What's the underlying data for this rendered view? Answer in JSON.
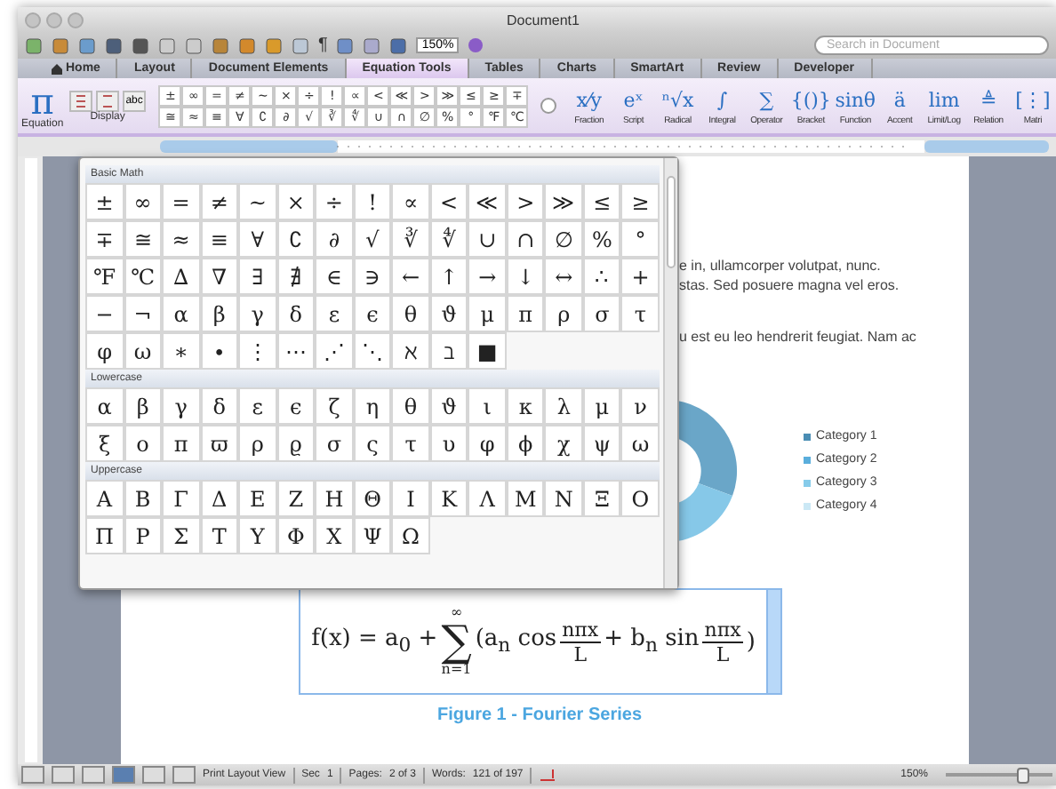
{
  "window": {
    "title": "Document1"
  },
  "toolbar": {
    "pilcrow": "¶",
    "zoom": "150%",
    "search_placeholder": "Search in Document"
  },
  "tabs": [
    {
      "label": "Home",
      "selected": false
    },
    {
      "label": "Layout",
      "selected": false
    },
    {
      "label": "Document Elements",
      "selected": false
    },
    {
      "label": "Equation Tools",
      "selected": true
    },
    {
      "label": "Tables",
      "selected": false
    },
    {
      "label": "Charts",
      "selected": false
    },
    {
      "label": "SmartArt",
      "selected": false
    },
    {
      "label": "Review",
      "selected": false
    },
    {
      "label": "Developer",
      "selected": false
    }
  ],
  "ribbon": {
    "equation": {
      "glyph": "π",
      "label": "Equation"
    },
    "display": {
      "label": "Display",
      "text_button": "abc"
    },
    "symbols": [
      [
        "±",
        "∞",
        "=",
        "≠",
        "~",
        "×",
        "÷",
        "!",
        "∝",
        "<",
        "≪",
        ">",
        "≫",
        "≤",
        "≥",
        "∓"
      ],
      [
        "≅",
        "≈",
        "≡",
        "∀",
        "∁",
        "∂",
        "√",
        "∛",
        "∜",
        "∪",
        "∩",
        "∅",
        "%",
        "°",
        "℉",
        "℃"
      ]
    ],
    "structures": [
      {
        "glyph": "x⁄y",
        "label": "Fraction"
      },
      {
        "glyph": "eˣ",
        "label": "Script"
      },
      {
        "glyph": "ⁿ√x",
        "label": "Radical"
      },
      {
        "glyph": "∫",
        "label": "Integral"
      },
      {
        "glyph": "∑",
        "label": "Operator"
      },
      {
        "glyph": "{()}",
        "label": "Bracket"
      },
      {
        "glyph": "sinθ",
        "label": "Function"
      },
      {
        "glyph": "ä",
        "label": "Accent"
      },
      {
        "glyph": "lim",
        "label": "Limit/Log"
      },
      {
        "glyph": "≜",
        "label": "Relation"
      },
      {
        "glyph": "[⋮]",
        "label": "Matri"
      }
    ]
  },
  "palette": {
    "sections": [
      {
        "title": "Basic Math",
        "rows": [
          [
            "±",
            "∞",
            "=",
            "≠",
            "~",
            "×",
            "÷",
            "!",
            "∝",
            "<",
            "≪",
            ">",
            "≫",
            "≤",
            "≥"
          ],
          [
            "∓",
            "≅",
            "≈",
            "≡",
            "∀",
            "∁",
            "∂",
            "√",
            "∛",
            "∜",
            "∪",
            "∩",
            "∅",
            "%",
            "°"
          ],
          [
            "℉",
            "℃",
            "∆",
            "∇",
            "∃",
            "∄",
            "∈",
            "∋",
            "←",
            "↑",
            "→",
            "↓",
            "↔",
            "∴",
            "+"
          ],
          [
            "−",
            "¬",
            "α",
            "β",
            "γ",
            "δ",
            "ε",
            "ϵ",
            "θ",
            "ϑ",
            "μ",
            "π",
            "ρ",
            "σ",
            "τ"
          ],
          [
            "φ",
            "ω",
            "∗",
            "∙",
            "⋮",
            "⋯",
            "⋰",
            "⋱",
            "ℵ",
            "ℶ",
            "■"
          ]
        ]
      },
      {
        "title": "Lowercase",
        "rows": [
          [
            "α",
            "β",
            "γ",
            "δ",
            "ε",
            "ϵ",
            "ζ",
            "η",
            "θ",
            "ϑ",
            "ι",
            "κ",
            "λ",
            "μ",
            "ν"
          ],
          [
            "ξ",
            "ο",
            "π",
            "ϖ",
            "ρ",
            "ϱ",
            "σ",
            "ς",
            "τ",
            "υ",
            "φ",
            "ϕ",
            "χ",
            "ψ",
            "ω"
          ]
        ]
      },
      {
        "title": "Uppercase",
        "rows": [
          [
            "Α",
            "Β",
            "Γ",
            "Δ",
            "Ε",
            "Ζ",
            "Η",
            "Θ",
            "Ι",
            "Κ",
            "Λ",
            "Μ",
            "Ν",
            "Ξ",
            "Ο"
          ],
          [
            "Π",
            "Ρ",
            "Σ",
            "Τ",
            "Υ",
            "Φ",
            "Χ",
            "Ψ",
            "Ω"
          ]
        ]
      }
    ]
  },
  "document": {
    "paragraphs": [
      [
        "e in, ullamcorper volutpat, nunc.",
        "stas. Sed posuere magna vel eros."
      ],
      [
        "u est eu leo hendrerit feugiat. Nam ac"
      ]
    ],
    "chart": {
      "legend": [
        {
          "label": "Category 1",
          "color": "#4a8db4"
        },
        {
          "label": "Category 2",
          "color": "#5aaedc"
        },
        {
          "label": "Category 3",
          "color": "#86cbea"
        },
        {
          "label": "Category 4",
          "color": "#cbe8f5"
        }
      ]
    },
    "equation": {
      "lhs": "f(x) = a$_{0}$ +",
      "sum_top": "∞",
      "sum_sign": "∑",
      "sum_bottom": "n=1",
      "open": "(a$_{n}$ cos",
      "frac1_num": "nπx",
      "frac1_den": "L",
      "middle": "+ b$_{n}$ sin",
      "frac2_num": "nπx",
      "frac2_den": "L",
      "close": ")"
    },
    "caption": "Figure 1 - Fourier Series"
  },
  "status_bar": {
    "view_buttons": [
      {
        "selected": false
      },
      {
        "selected": false
      },
      {
        "selected": false
      },
      {
        "selected": true
      },
      {
        "selected": false
      },
      {
        "selected": false
      }
    ],
    "view": "Print Layout View",
    "sec_label": "Sec",
    "sec": "1",
    "pages_label": "Pages:",
    "pages": "2 of 3",
    "words_label": "Words:",
    "words": "121 of 197",
    "zoom": "150%",
    "zoom_slider": {
      "level": 0.72
    }
  }
}
